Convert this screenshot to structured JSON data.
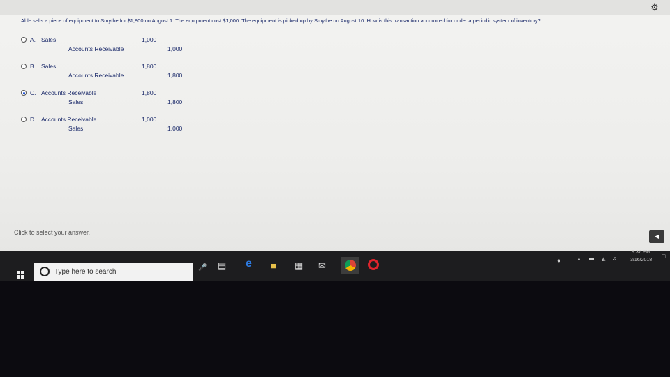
{
  "question": "Able sells a piece of equipment to Smythe for $1,800 on August 1. The equipment cost $1,000. The equipment is picked up by Smythe on August 10. How is this transaction accounted for under a periodic system of inventory?",
  "options": [
    {
      "letter": "A.",
      "debit_account": "Sales",
      "debit_amount": "1,000",
      "credit_account": "Accounts Receivable",
      "credit_amount": "1,000",
      "selected": false
    },
    {
      "letter": "B.",
      "debit_account": "Sales",
      "debit_amount": "1,800",
      "credit_account": "Accounts Receivable",
      "credit_amount": "1,800",
      "selected": false
    },
    {
      "letter": "C.",
      "debit_account": "Accounts Receivable",
      "debit_amount": "1,800",
      "credit_account": "Sales",
      "credit_amount": "1,800",
      "selected": true
    },
    {
      "letter": "D.",
      "debit_account": "Accounts Receivable",
      "debit_amount": "1,000",
      "credit_account": "Sales",
      "credit_amount": "1,000",
      "selected": false
    }
  ],
  "hint": "Click to select your answer.",
  "taskbar": {
    "search_placeholder": "Type here to search",
    "clock_time": "9:37 PM",
    "clock_date": "3/16/2018"
  },
  "icons": {
    "settings": "gear-icon",
    "back": "back-arrow-icon",
    "start": "windows-icon",
    "task_view": "task-view-icon",
    "edge": "edge-icon",
    "file_explorer": "folder-icon",
    "store": "store-icon",
    "mail": "mail-icon",
    "chrome": "chrome-icon",
    "opera": "opera-icon"
  }
}
